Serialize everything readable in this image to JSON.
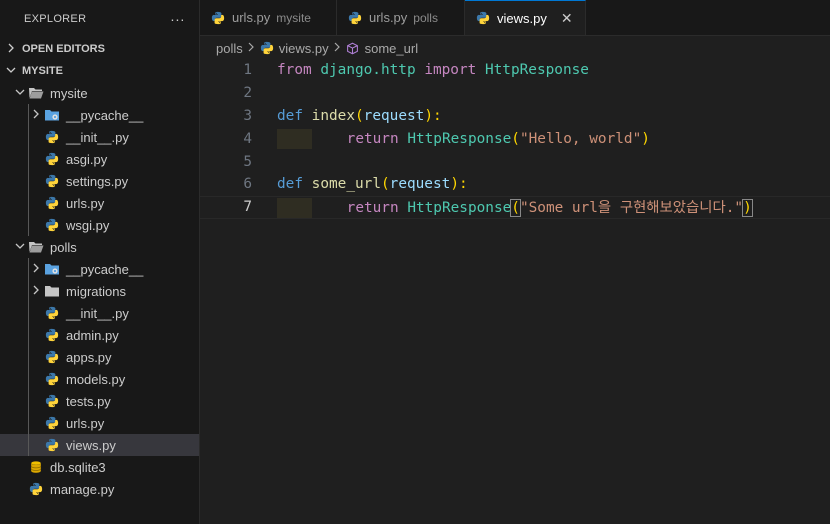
{
  "explorer": {
    "title": "EXPLORER",
    "more": "···",
    "open_editors": "OPEN EDITORS",
    "root": "MYSITE",
    "tree": [
      {
        "label": "mysite",
        "kind": "folder-open",
        "depth": 1
      },
      {
        "label": "__pycache__",
        "kind": "folder-closed-special",
        "depth": 2
      },
      {
        "label": "__init__.py",
        "kind": "py",
        "depth": 2
      },
      {
        "label": "asgi.py",
        "kind": "py",
        "depth": 2
      },
      {
        "label": "settings.py",
        "kind": "py",
        "depth": 2
      },
      {
        "label": "urls.py",
        "kind": "py",
        "depth": 2
      },
      {
        "label": "wsgi.py",
        "kind": "py",
        "depth": 2
      },
      {
        "label": "polls",
        "kind": "folder-open",
        "depth": 1
      },
      {
        "label": "__pycache__",
        "kind": "folder-closed-special",
        "depth": 2
      },
      {
        "label": "migrations",
        "kind": "folder-closed",
        "depth": 2
      },
      {
        "label": "__init__.py",
        "kind": "py",
        "depth": 2
      },
      {
        "label": "admin.py",
        "kind": "py",
        "depth": 2
      },
      {
        "label": "apps.py",
        "kind": "py",
        "depth": 2
      },
      {
        "label": "models.py",
        "kind": "py",
        "depth": 2
      },
      {
        "label": "tests.py",
        "kind": "py",
        "depth": 2
      },
      {
        "label": "urls.py",
        "kind": "py",
        "depth": 2
      },
      {
        "label": "views.py",
        "kind": "py",
        "depth": 2,
        "selected": true
      },
      {
        "label": "db.sqlite3",
        "kind": "db",
        "depth": 1
      },
      {
        "label": "manage.py",
        "kind": "py",
        "depth": 1
      }
    ]
  },
  "tabs": [
    {
      "label": "urls.py",
      "desc": "mysite"
    },
    {
      "label": "urls.py",
      "desc": "polls"
    },
    {
      "label": "views.py",
      "desc": "",
      "active": true,
      "close": "✕"
    }
  ],
  "breadcrumb": {
    "folder": "polls",
    "file": "views.py",
    "symbol": "some_url"
  },
  "code": {
    "line_numbers": [
      "1",
      "2",
      "3",
      "4",
      "5",
      "6",
      "7"
    ],
    "l1": {
      "from": "from",
      "mod": "django.http",
      "import": "import",
      "cls": "HttpResponse"
    },
    "l3": {
      "def": "def",
      "name": "index",
      "open": "(",
      "param": "request",
      "close": "):"
    },
    "l4": {
      "ret": "return",
      "cls": "HttpResponse",
      "open": "(",
      "str": "\"Hello, world\"",
      "close": ")"
    },
    "l6": {
      "def": "def",
      "name": "some_url",
      "open": "(",
      "param": "request",
      "close": "):"
    },
    "l7": {
      "ret": "return",
      "cls": "HttpResponse",
      "open": "(",
      "str": "\"Some url을 구현해보았습니다.\"",
      "close": ")"
    }
  }
}
